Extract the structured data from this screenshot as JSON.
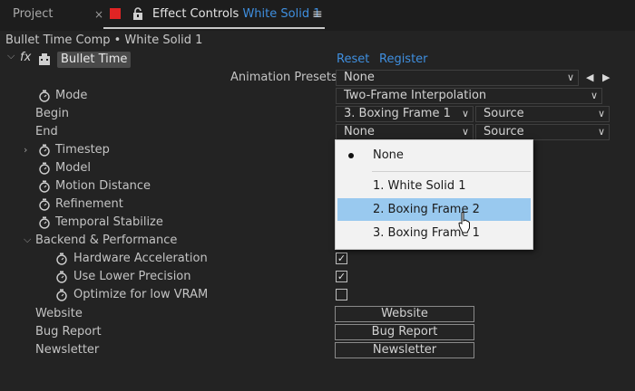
{
  "tabs": {
    "project": "Project",
    "close": "×",
    "effect_controls": "Effect Controls",
    "layer_name": "White Solid 1",
    "menu": "≡"
  },
  "breadcrumb": "Bullet Time Comp • White Solid 1",
  "effect": {
    "fx": "fx",
    "name": "Bullet Time",
    "reset": "Reset",
    "register": "Register"
  },
  "props": {
    "animation_presets": "Animation Presets:",
    "animation_presets_value": "None",
    "mode": "Mode",
    "mode_value": "Two-Frame Interpolation",
    "begin": "Begin",
    "begin_value": "3. Boxing Frame 1",
    "begin_source": "Source",
    "end": "End",
    "end_value": "None",
    "end_source": "Source",
    "timestep": "Timestep",
    "model": "Model",
    "motion_distance": "Motion Distance",
    "refinement": "Refinement",
    "temporal_stabilize": "Temporal Stabilize",
    "backend_group": "Backend & Performance",
    "hardware_acceleration": "Hardware Acceleration",
    "use_lower_precision": "Use Lower Precision",
    "optimize_low_vram": "Optimize for low VRAM",
    "website": "Website",
    "bug_report": "Bug Report",
    "newsletter": "Newsletter"
  },
  "checkboxes": {
    "hardware_acceleration": "✓",
    "use_lower_precision": "✓",
    "optimize_low_vram": ""
  },
  "buttons": {
    "website": "Website",
    "bug_report": "Bug Report",
    "newsletter": "Newsletter"
  },
  "dropdown_menu": {
    "items": [
      "None",
      "1. White Solid 1",
      "2. Boxing Frame 2",
      "3. Boxing Frame 1"
    ],
    "selected": "None",
    "highlighted": "2. Boxing Frame 2"
  },
  "colors": {
    "accent_blue": "#3f8fdf",
    "highlight": "#99c9ef",
    "panel_bg": "#232323",
    "tab_bar_bg": "#1d1d1d",
    "label_color_swatch": "#e02424"
  }
}
